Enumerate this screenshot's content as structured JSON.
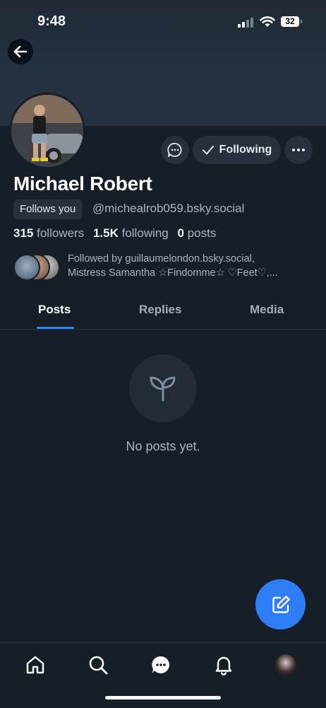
{
  "status_bar": {
    "time": "9:48",
    "battery": "32"
  },
  "profile": {
    "name": "Michael Robert",
    "follows_you_badge": "Follows you",
    "handle": "@michealrob059.bsky.social",
    "followers_count": "315",
    "followers_label": "followers",
    "following_count": "1.5K",
    "following_label": "following",
    "posts_count": "0",
    "posts_label": "posts",
    "followed_by_line1": "Followed by guillaumelondon.bsky.social,",
    "followed_by_line2": "Mistress Samantha ☆Findomme☆ ♡Feet♡,..."
  },
  "actions": {
    "following_label": "Following"
  },
  "tabs": [
    {
      "label": "Posts",
      "active": true
    },
    {
      "label": "Replies",
      "active": false
    },
    {
      "label": "Media",
      "active": false
    }
  ],
  "empty_state": {
    "text": "No posts yet.",
    "icon": "sprout-icon"
  },
  "bottom_nav": [
    "home-icon",
    "search-icon",
    "chat-icon",
    "bell-icon",
    "profile-avatar"
  ],
  "colors": {
    "background": "#161e27",
    "accent": "#1e8bff",
    "fab": "#2e7cf6"
  }
}
